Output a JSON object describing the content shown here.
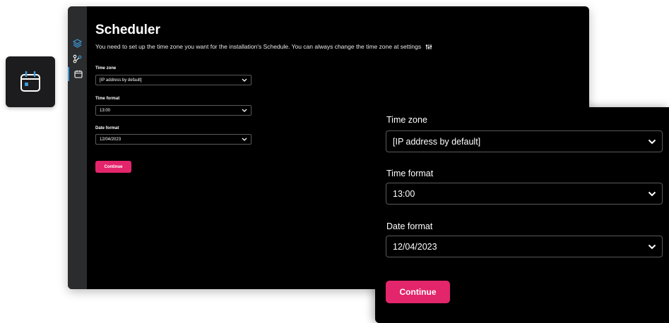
{
  "icons": {
    "badge": "calendar-icon",
    "rail": [
      "layers-icon",
      "flow-icon",
      "calendar-icon"
    ],
    "settings": "settings-sliders-icon",
    "chevron": "chevron-down-icon"
  },
  "colors": {
    "accent": "#3d9dde",
    "primary_button": "#e3256b",
    "background": "#000000",
    "rail": "#2b2c2e"
  },
  "page": {
    "title": "Scheduler",
    "description": "You need to set up the time zone you want for the installation's Schedule. You can always change the time zone at settings"
  },
  "form": {
    "time_zone": {
      "label": "Time zone",
      "value": "[IP address by default]"
    },
    "time_format": {
      "label": "Time format",
      "value": "13:00"
    },
    "date_format": {
      "label": "Date format",
      "value": "12/04/2023"
    },
    "continue_label": "Continue"
  }
}
